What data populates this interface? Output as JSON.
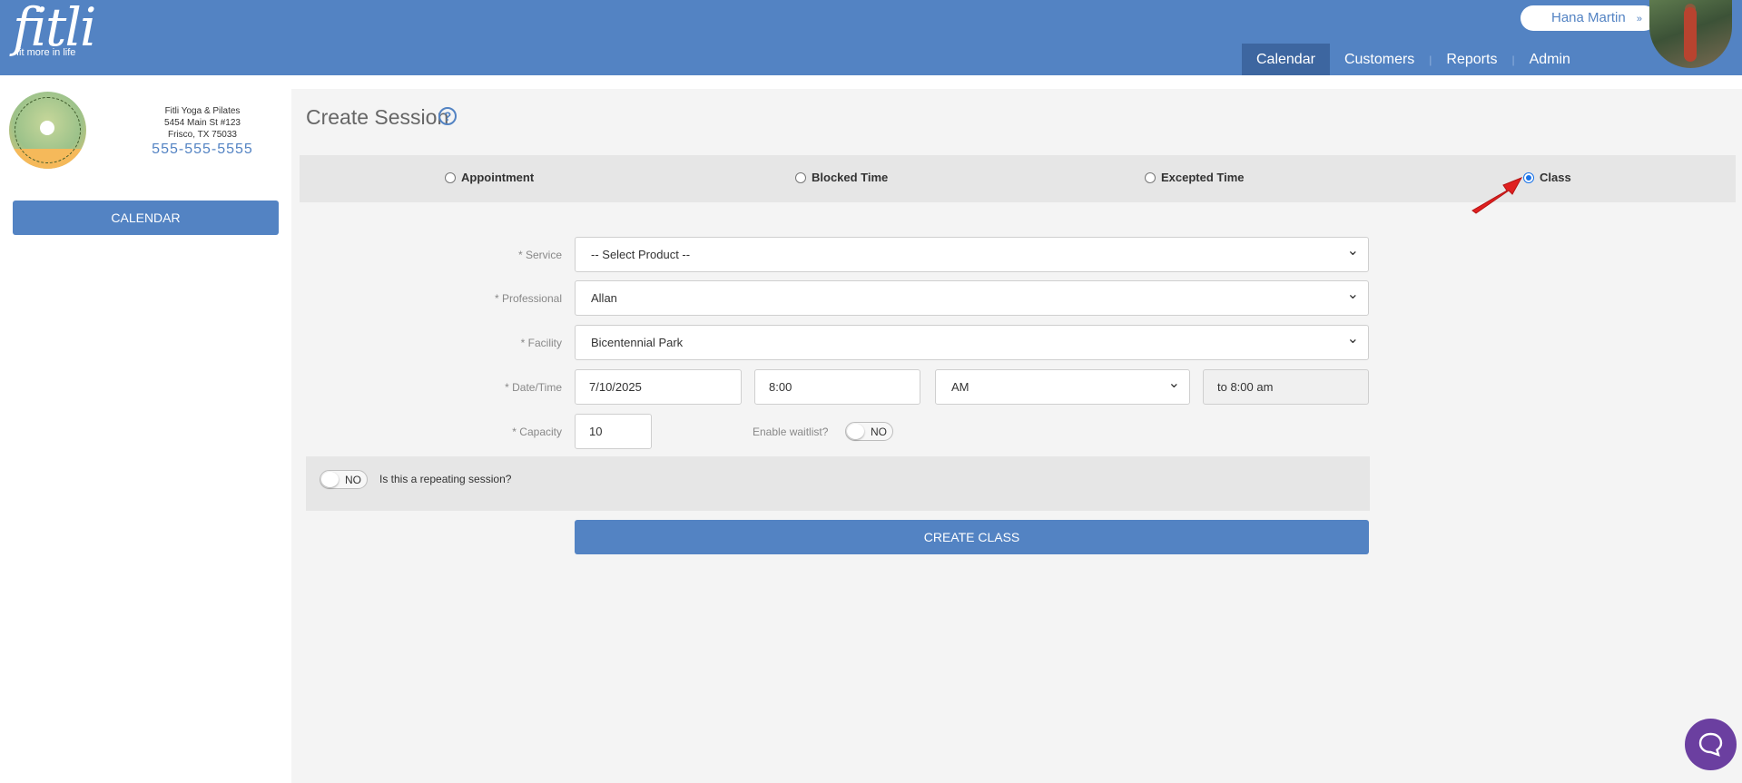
{
  "header": {
    "logo_text": "fitli",
    "logo_tagline": "fit more in life",
    "user_name": "Hana Martin",
    "nav": [
      {
        "label": "Calendar",
        "active": true
      },
      {
        "label": "Customers",
        "active": false
      },
      {
        "label": "Reports",
        "active": false
      },
      {
        "label": "Admin",
        "active": false
      }
    ]
  },
  "sidebar": {
    "business_name": "Fitli Yoga & Pilates",
    "address_line1": "5454 Main St #123",
    "address_line2": "Frisco, TX 75033",
    "phone": "555-555-5555",
    "calendar_button": "CALENDAR"
  },
  "main": {
    "title": "Create Session",
    "help_icon": "?",
    "session_types": [
      {
        "label": "Appointment",
        "checked": false
      },
      {
        "label": "Blocked Time",
        "checked": false
      },
      {
        "label": "Excepted Time",
        "checked": false
      },
      {
        "label": "Class",
        "checked": true
      }
    ],
    "form": {
      "service_label": "* Service",
      "service_value": "-- Select Product --",
      "professional_label": "* Professional",
      "professional_value": "Allan",
      "facility_label": "* Facility",
      "facility_value": "Bicentennial Park",
      "datetime_label": "* Date/Time",
      "date_value": "7/10/2025",
      "time_value": "8:00",
      "ampm_value": "AM",
      "end_time": "to 8:00 am",
      "capacity_label": "* Capacity",
      "capacity_value": "10",
      "waitlist_label": "Enable waitlist?",
      "waitlist_toggle": "NO",
      "repeat_toggle": "NO",
      "repeat_label": "Is this a repeating session?",
      "create_button": "CREATE CLASS"
    }
  },
  "colors": {
    "primary": "#5383c3",
    "nav_active": "#3d66a0",
    "panel_bg": "#f4f4f4",
    "chat_button": "#6b3fa0",
    "annotation_arrow": "#e02020"
  },
  "icons": {
    "help": "question-circle-icon",
    "user_menu": "chevron-down-icon",
    "chat": "chat-bubble-icon",
    "annotation": "red-arrow-icon"
  }
}
